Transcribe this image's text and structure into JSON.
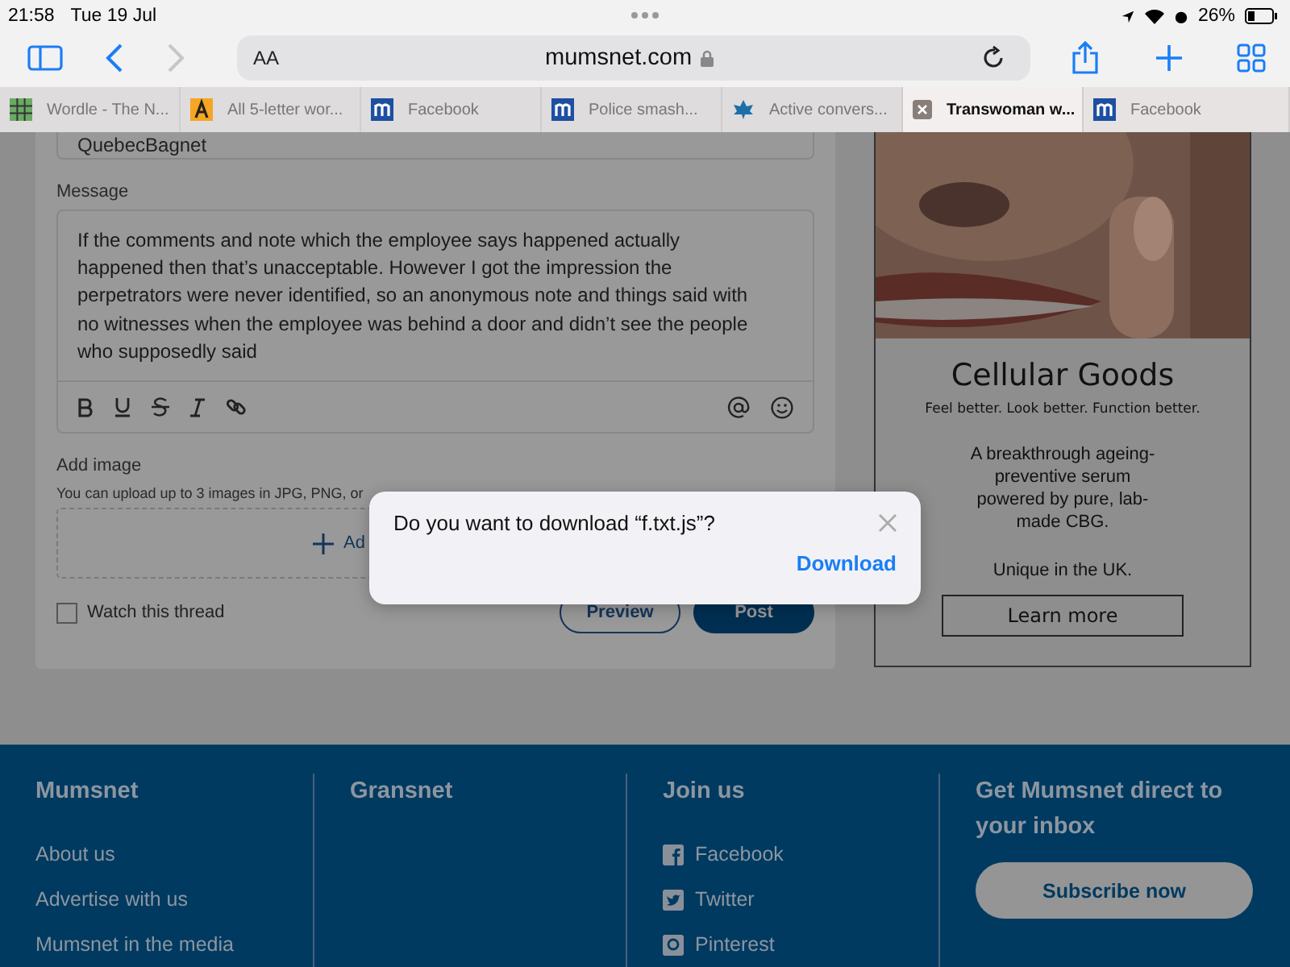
{
  "status_bar": {
    "time": "21:58",
    "date": "Tue 19 Jul",
    "battery": "26%"
  },
  "toolbar": {
    "text_size": "AA",
    "url": "mumsnet.com",
    "back_enabled": true,
    "forward_enabled": false
  },
  "tabs": [
    {
      "title": "Wordle - The N...",
      "kind": "grid",
      "selected": false
    },
    {
      "title": "All 5-letter wor...",
      "kind": "letter",
      "selected": false
    },
    {
      "title": "Facebook",
      "kind": "site",
      "selected": false
    },
    {
      "title": "Police smash...",
      "kind": "site",
      "selected": false
    },
    {
      "title": "Active convers...",
      "kind": "leaf",
      "selected": false
    },
    {
      "title": "Transwoman w...",
      "kind": "closable",
      "selected": true
    },
    {
      "title": "Facebook",
      "kind": "site",
      "selected": false
    }
  ],
  "form": {
    "username_value": "QuebecBagnet",
    "message_label": "Message",
    "message_value": "If the comments and note which the employee says happened actually happened then that’s unacceptable.  However I got the impression the perpetrators were never identified, so an anonymous note and things said with no witnesses when the employee was behind a door and didn’t see the people who supposedly said",
    "add_image_label": "Add image",
    "upload_hint": "You can upload up to 3 images in JPG, PNG, or",
    "add_button": "Ad",
    "watch": {
      "label": "Watch this thread",
      "checked": false
    },
    "preview": "Preview",
    "post": "Post"
  },
  "ad": {
    "brand": "Cellular Goods",
    "tagline": "Feel better. Look better. Function better.",
    "body": "A breakthrough ageing-preventive serum powered by pure, lab-made CBG.",
    "note": "Unique in the UK.",
    "cta": "Learn more"
  },
  "dialog": {
    "message": "Do you want to download “f.txt.js”?",
    "action": "Download"
  },
  "footer": {
    "columns": [
      {
        "heading": "Mumsnet",
        "links": [
          {
            "label": "About us"
          },
          {
            "label": "Advertise with us"
          },
          {
            "label": "Mumsnet in the media"
          }
        ]
      },
      {
        "heading": "Gransnet"
      },
      {
        "heading": "Join us",
        "links": [
          {
            "label": "Facebook",
            "kind": "facebook"
          },
          {
            "label": "Twitter",
            "kind": "twitter"
          },
          {
            "label": "Pinterest",
            "kind": "pinterest"
          }
        ]
      },
      {
        "heading": "Get Mumsnet direct to your inbox",
        "button": "Subscribe now"
      }
    ]
  }
}
